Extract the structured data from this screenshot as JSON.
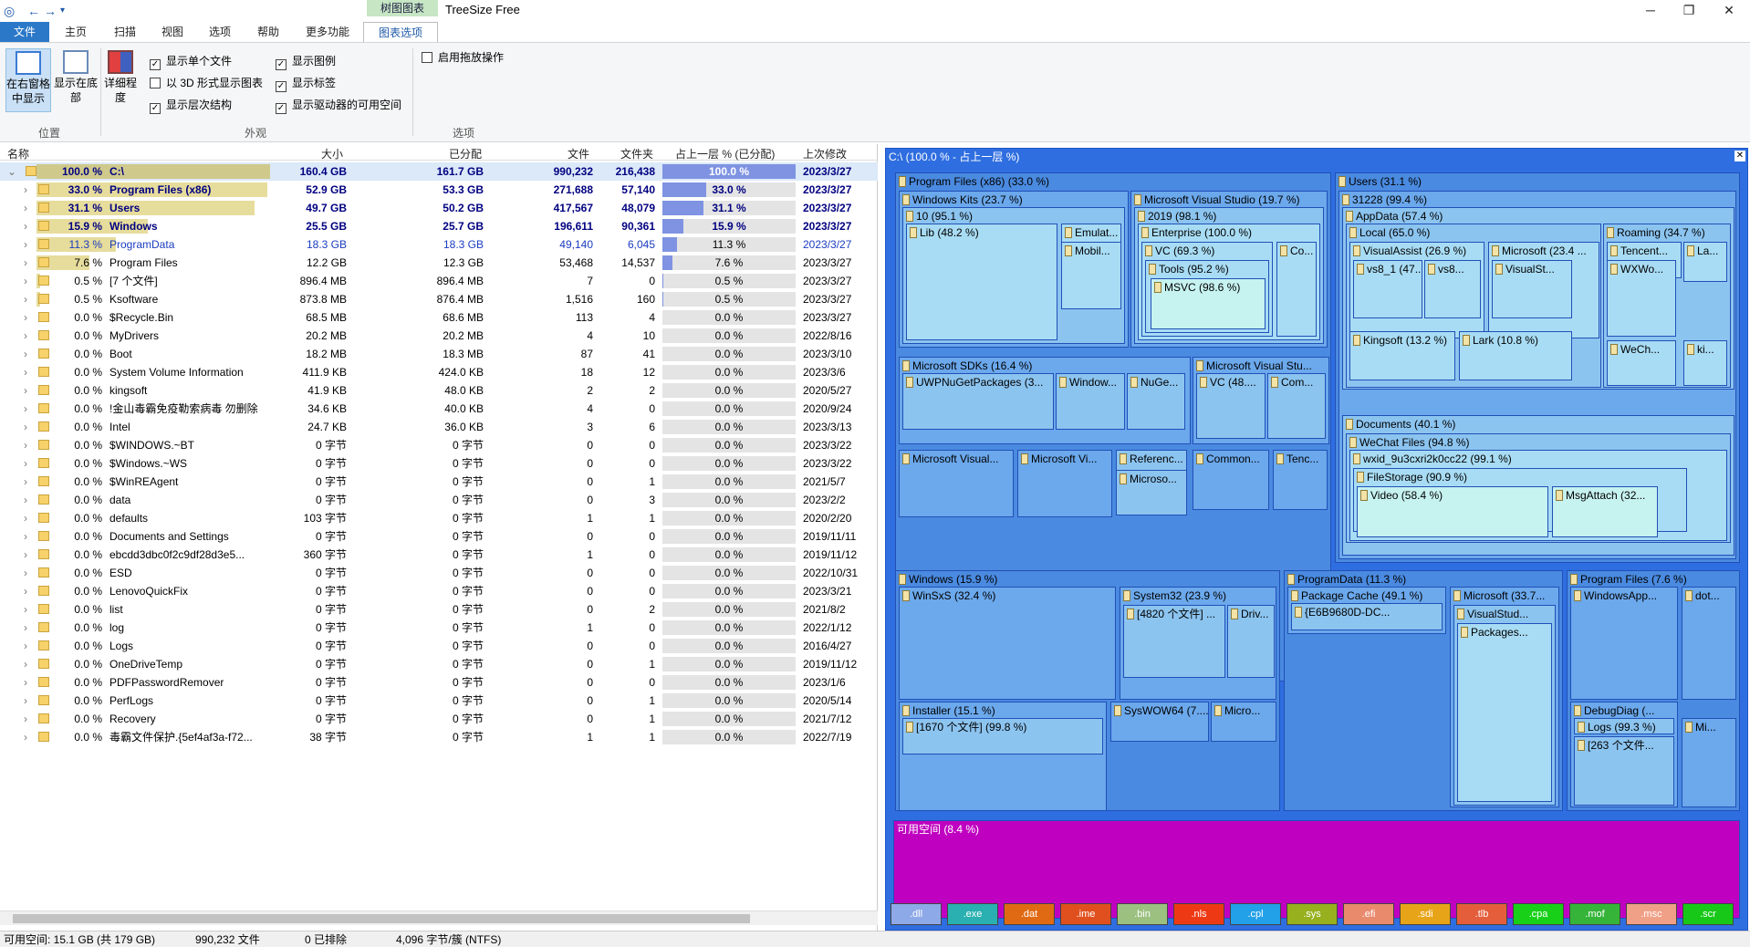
{
  "window": {
    "context_tab": "树图图表",
    "title": "TreeSize Free",
    "minimize": "─",
    "maximize": "❐",
    "close": "✕"
  },
  "tabs": [
    "文件",
    "主页",
    "扫描",
    "视图",
    "选项",
    "帮助",
    "更多功能",
    "图表选项"
  ],
  "ribbon": {
    "btn_right": "在右窗格中显示",
    "btn_bottom": "显示在底部",
    "btn_detail": "详细程度",
    "chk": [
      {
        "label": "显示单个文件",
        "checked": true
      },
      {
        "label": "以 3D 形式显示图表",
        "checked": false
      },
      {
        "label": "显示层次结构",
        "checked": true
      },
      {
        "label": "显示图例",
        "checked": true
      },
      {
        "label": "显示标签",
        "checked": true
      },
      {
        "label": "显示驱动器的可用空间",
        "checked": true
      },
      {
        "label": "启用拖放操作",
        "checked": false
      }
    ],
    "groups": [
      "位置",
      "外观",
      "选项"
    ]
  },
  "columns": [
    "名称",
    "大小",
    "已分配",
    "文件",
    "文件夹",
    "占上一层 % (已分配)",
    "上次修改"
  ],
  "rows": [
    {
      "pct": "100.0 %",
      "name": "C:\\",
      "size": "160.4 GB",
      "alloc": "161.7 GB",
      "files": "990,232",
      "folders": "216,438",
      "share": "100.0 %",
      "fill": 1.0,
      "date": "2023/3/27",
      "bold": true
    },
    {
      "pct": "33.0 %",
      "name": "Program Files (x86)",
      "size": "52.9 GB",
      "alloc": "53.3 GB",
      "files": "271,688",
      "folders": "57,140",
      "share": "33.0 %",
      "fill": 0.33,
      "date": "2023/3/27",
      "bold": true
    },
    {
      "pct": "31.1 %",
      "name": "Users",
      "size": "49.7 GB",
      "alloc": "50.2 GB",
      "files": "417,567",
      "folders": "48,079",
      "share": "31.1 %",
      "fill": 0.311,
      "date": "2023/3/27",
      "bold": true
    },
    {
      "pct": "15.9 %",
      "name": "Windows",
      "size": "25.5 GB",
      "alloc": "25.7 GB",
      "files": "196,611",
      "folders": "90,361",
      "share": "15.9 %",
      "fill": 0.159,
      "date": "2023/3/27",
      "bold": true
    },
    {
      "pct": "11.3 %",
      "name": "ProgramData",
      "size": "18.3 GB",
      "alloc": "18.3 GB",
      "files": "49,140",
      "folders": "6,045",
      "share": "11.3 %",
      "fill": 0.113,
      "date": "2023/3/27",
      "blue": true
    },
    {
      "pct": "7.6 %",
      "name": "Program Files",
      "size": "12.2 GB",
      "alloc": "12.3 GB",
      "files": "53,468",
      "folders": "14,537",
      "share": "7.6 %",
      "fill": 0.076,
      "date": "2023/3/27"
    },
    {
      "pct": "0.5 %",
      "name": "[7 个文件]",
      "size": "896.4 MB",
      "alloc": "896.4 MB",
      "files": "7",
      "folders": "0",
      "share": "0.5 %",
      "fill": 0.005,
      "date": "2023/3/27"
    },
    {
      "pct": "0.5 %",
      "name": "Ksoftware",
      "size": "873.8 MB",
      "alloc": "876.4 MB",
      "files": "1,516",
      "folders": "160",
      "share": "0.5 %",
      "fill": 0.005,
      "date": "2023/3/27"
    },
    {
      "pct": "0.0 %",
      "name": "$Recycle.Bin",
      "size": "68.5 MB",
      "alloc": "68.6 MB",
      "files": "113",
      "folders": "4",
      "share": "0.0 %",
      "fill": 0,
      "date": "2023/3/27"
    },
    {
      "pct": "0.0 %",
      "name": "MyDrivers",
      "size": "20.2 MB",
      "alloc": "20.2 MB",
      "files": "4",
      "folders": "10",
      "share": "0.0 %",
      "fill": 0,
      "date": "2022/8/16"
    },
    {
      "pct": "0.0 %",
      "name": "Boot",
      "size": "18.2 MB",
      "alloc": "18.3 MB",
      "files": "87",
      "folders": "41",
      "share": "0.0 %",
      "fill": 0,
      "date": "2023/3/10"
    },
    {
      "pct": "0.0 %",
      "name": "System Volume Information",
      "size": "411.9 KB",
      "alloc": "424.0 KB",
      "files": "18",
      "folders": "12",
      "share": "0.0 %",
      "fill": 0,
      "date": "2023/3/6"
    },
    {
      "pct": "0.0 %",
      "name": "kingsoft",
      "size": "41.9 KB",
      "alloc": "48.0 KB",
      "files": "2",
      "folders": "2",
      "share": "0.0 %",
      "fill": 0,
      "date": "2020/5/27"
    },
    {
      "pct": "0.0 %",
      "name": "!金山毒霸免疫勒索病毒 勿删除",
      "size": "34.6 KB",
      "alloc": "40.0 KB",
      "files": "4",
      "folders": "0",
      "share": "0.0 %",
      "fill": 0,
      "date": "2020/9/24"
    },
    {
      "pct": "0.0 %",
      "name": "Intel",
      "size": "24.7 KB",
      "alloc": "36.0 KB",
      "files": "3",
      "folders": "6",
      "share": "0.0 %",
      "fill": 0,
      "date": "2023/3/13"
    },
    {
      "pct": "0.0 %",
      "name": "$WINDOWS.~BT",
      "size": "0 字节",
      "alloc": "0 字节",
      "files": "0",
      "folders": "0",
      "share": "0.0 %",
      "fill": 0,
      "date": "2023/3/22"
    },
    {
      "pct": "0.0 %",
      "name": "$Windows.~WS",
      "size": "0 字节",
      "alloc": "0 字节",
      "files": "0",
      "folders": "0",
      "share": "0.0 %",
      "fill": 0,
      "date": "2023/3/22"
    },
    {
      "pct": "0.0 %",
      "name": "$WinREAgent",
      "size": "0 字节",
      "alloc": "0 字节",
      "files": "0",
      "folders": "1",
      "share": "0.0 %",
      "fill": 0,
      "date": "2021/5/7"
    },
    {
      "pct": "0.0 %",
      "name": "data",
      "size": "0 字节",
      "alloc": "0 字节",
      "files": "0",
      "folders": "3",
      "share": "0.0 %",
      "fill": 0,
      "date": "2023/2/2"
    },
    {
      "pct": "0.0 %",
      "name": "defaults",
      "size": "103 字节",
      "alloc": "0 字节",
      "files": "1",
      "folders": "1",
      "share": "0.0 %",
      "fill": 0,
      "date": "2020/2/20"
    },
    {
      "pct": "0.0 %",
      "name": "Documents and Settings",
      "size": "0 字节",
      "alloc": "0 字节",
      "files": "0",
      "folders": "0",
      "share": "0.0 %",
      "fill": 0,
      "date": "2019/11/11"
    },
    {
      "pct": "0.0 %",
      "name": "ebcdd3dbc0f2c9df28d3e5...",
      "size": "360 字节",
      "alloc": "0 字节",
      "files": "1",
      "folders": "0",
      "share": "0.0 %",
      "fill": 0,
      "date": "2019/11/12"
    },
    {
      "pct": "0.0 %",
      "name": "ESD",
      "size": "0 字节",
      "alloc": "0 字节",
      "files": "0",
      "folders": "0",
      "share": "0.0 %",
      "fill": 0,
      "date": "2022/10/31"
    },
    {
      "pct": "0.0 %",
      "name": "LenovoQuickFix",
      "size": "0 字节",
      "alloc": "0 字节",
      "files": "0",
      "folders": "0",
      "share": "0.0 %",
      "fill": 0,
      "date": "2023/3/21"
    },
    {
      "pct": "0.0 %",
      "name": "list",
      "size": "0 字节",
      "alloc": "0 字节",
      "files": "0",
      "folders": "2",
      "share": "0.0 %",
      "fill": 0,
      "date": "2021/8/2"
    },
    {
      "pct": "0.0 %",
      "name": "log",
      "size": "0 字节",
      "alloc": "0 字节",
      "files": "1",
      "folders": "0",
      "share": "0.0 %",
      "fill": 0,
      "date": "2022/1/12"
    },
    {
      "pct": "0.0 %",
      "name": "Logs",
      "size": "0 字节",
      "alloc": "0 字节",
      "files": "0",
      "folders": "0",
      "share": "0.0 %",
      "fill": 0,
      "date": "2016/4/27"
    },
    {
      "pct": "0.0 %",
      "name": "OneDriveTemp",
      "size": "0 字节",
      "alloc": "0 字节",
      "files": "0",
      "folders": "1",
      "share": "0.0 %",
      "fill": 0,
      "date": "2019/11/12"
    },
    {
      "pct": "0.0 %",
      "name": "PDFPasswordRemover",
      "size": "0 字节",
      "alloc": "0 字节",
      "files": "0",
      "folders": "0",
      "share": "0.0 %",
      "fill": 0,
      "date": "2023/1/6"
    },
    {
      "pct": "0.0 %",
      "name": "PerfLogs",
      "size": "0 字节",
      "alloc": "0 字节",
      "files": "0",
      "folders": "1",
      "share": "0.0 %",
      "fill": 0,
      "date": "2020/5/14"
    },
    {
      "pct": "0.0 %",
      "name": "Recovery",
      "size": "0 字节",
      "alloc": "0 字节",
      "files": "0",
      "folders": "1",
      "share": "0.0 %",
      "fill": 0,
      "date": "2021/7/12"
    },
    {
      "pct": "0.0 %",
      "name": "毒霸文件保护.{5ef4af3a-f72...",
      "size": "38 字节",
      "alloc": "0 字节",
      "files": "1",
      "folders": "1",
      "share": "0.0 %",
      "fill": 0,
      "date": "2022/7/19"
    }
  ],
  "treemap": {
    "root": "C:\\ (100.0 % - 占上一层 %)",
    "labels": [
      "Program Files (x86) (33.0 %)",
      "Windows Kits (23.7 %)",
      "10 (95.1 %)",
      "Lib (48.2 %)",
      "Emulat...",
      "Mobil...",
      "Microsoft Visual Studio (19.7 %)",
      "2019 (98.1 %)",
      "Enterprise (100.0 %)",
      "VC (69.3 %)",
      "Co...",
      "Tools (95.2 %)",
      "MSVC (98.6 %)",
      "Microsoft SDKs (16.4 %)",
      "UWPNuGetPackages (3...",
      "Window...",
      "NuGe...",
      "Microsoft Visual Stu...",
      "VC (48....",
      "Com...",
      "Microsoft Visual...",
      "Microsoft Vi...",
      "Referenc...",
      "Microso...",
      "Common...",
      "Tenc...",
      "Users (31.1 %)",
      "31228 (99.4 %)",
      "AppData (57.4 %)",
      "Local (65.0 %)",
      "VisualAssist (26.9 %)",
      "vs8_1 (47....",
      "vs8...",
      "Microsoft (23.4 ...",
      "VisualSt...",
      "Roaming (34.7 %)",
      "Tencent...",
      "La...",
      "WXWo...",
      "WeCh...",
      "ki...",
      "Kingsoft (13.2 %)",
      "Lark (10.8 %)",
      "Documents (40.1 %)",
      "WeChat Files (94.8 %)",
      "wxid_9u3cxri2k0cc22 (99.1 %)",
      "FileStorage (90.9 %)",
      "Video (58.4 %)",
      "MsgAttach (32...",
      "Windows (15.9 %)",
      "WinSxS (32.4 %)",
      "System32 (23.9 %)",
      "[4820 个文件] ...",
      "Driv...",
      "Installer (15.1 %)",
      "[1670 个文件] (99.8 %)",
      "SysWOW64 (7....",
      "Micro...",
      "ProgramData (11.3 %)",
      "Package Cache (49.1 %)",
      "{E6B9680D-DC...",
      "Microsoft (33.7...",
      "VisualStud...",
      "Packages...",
      "Program Files (7.6 %)",
      "WindowsApp...",
      "dot...",
      "DebugDiag (...",
      "Logs (99.3 %)",
      "[263 个文件...",
      "Mi...",
      "可用空间 (8.4 %)"
    ],
    "close": "✕"
  },
  "legend": [
    {
      "ext": ".dll",
      "color": "#8ea9e8"
    },
    {
      "ext": ".exe",
      "color": "#2ab0b0"
    },
    {
      "ext": ".dat",
      "color": "#e06a14"
    },
    {
      "ext": ".ime",
      "color": "#e0501e"
    },
    {
      "ext": ".bin",
      "color": "#9cc080"
    },
    {
      "ext": ".nls",
      "color": "#ee3a14"
    },
    {
      "ext": ".cpl",
      "color": "#22a0e8"
    },
    {
      "ext": ".sys",
      "color": "#96b01e"
    },
    {
      "ext": ".efi",
      "color": "#ea8a6c"
    },
    {
      "ext": ".sdi",
      "color": "#e8a418"
    },
    {
      "ext": ".tlb",
      "color": "#e45e3c"
    },
    {
      "ext": ".cpa",
      "color": "#18d018"
    },
    {
      "ext": ".mof",
      "color": "#36b43a"
    },
    {
      "ext": ".msc",
      "color": "#f0a086"
    },
    {
      "ext": ".scr",
      "color": "#18c818"
    }
  ],
  "status": {
    "free": "可用空间: 15.1 GB (共 179 GB)",
    "files": "990,232 文件",
    "excluded": "0 已排除",
    "cluster": "4,096 字节/簇 (NTFS)"
  }
}
